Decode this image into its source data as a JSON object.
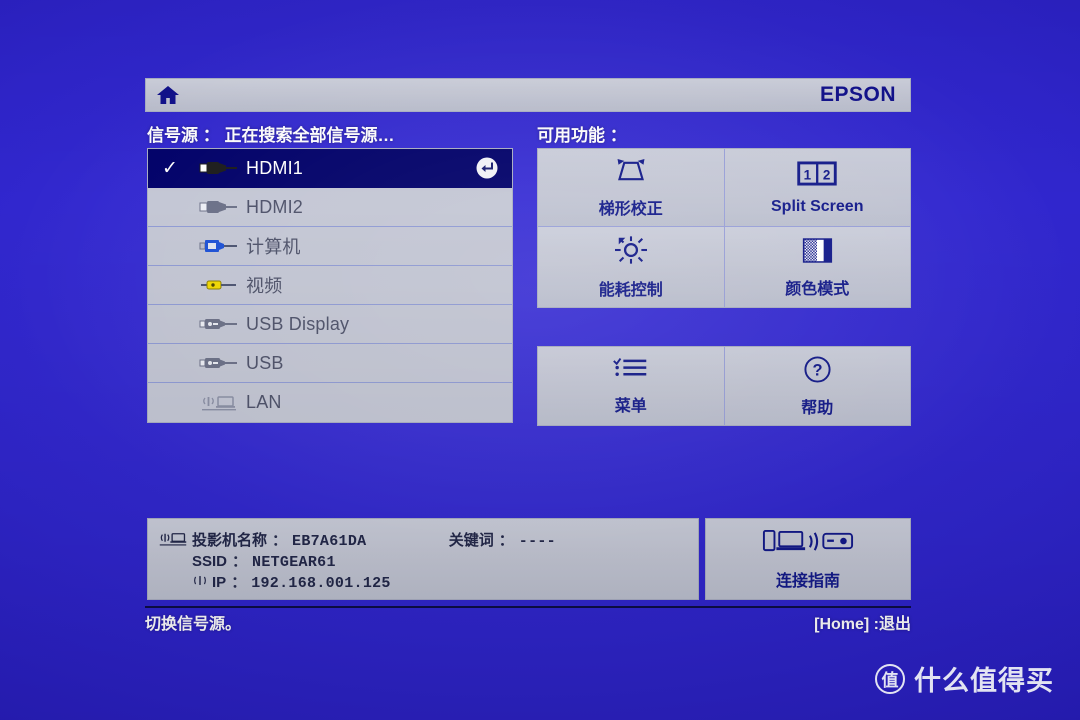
{
  "colors": {
    "background_blue": "#2f25cc",
    "panel_gray": "#c3c6d4",
    "selected_navy": "#000069",
    "icon_navy": "#131a8a",
    "text_white": "#ffffff"
  },
  "header": {
    "home_icon": "home-icon",
    "brand": "EPSON"
  },
  "source_section": {
    "label": "信号源 ： 正在搜索全部信号源…",
    "items": [
      {
        "label": "HDMI1",
        "icon": "hdmi-connector-icon",
        "selected": true,
        "check": "✓",
        "enter_icon": "enter-key-icon"
      },
      {
        "label": "HDMI2",
        "icon": "hdmi-connector-icon",
        "selected": false,
        "check": "",
        "enter_icon": ""
      },
      {
        "label": "计算机",
        "icon": "vga-computer-connector-icon",
        "selected": false,
        "check": "",
        "enter_icon": ""
      },
      {
        "label": "视频",
        "icon": "rca-video-connector-icon",
        "selected": false,
        "check": "",
        "enter_icon": ""
      },
      {
        "label": "USB Display",
        "icon": "usb-connector-icon",
        "selected": false,
        "check": "",
        "enter_icon": ""
      },
      {
        "label": "USB",
        "icon": "usb-connector-icon",
        "selected": false,
        "check": "",
        "enter_icon": ""
      },
      {
        "label": "LAN",
        "icon": "lan-network-icon",
        "selected": false,
        "check": "",
        "enter_icon": ""
      }
    ]
  },
  "function_section": {
    "label": "可用功能 ：",
    "top_grid": [
      {
        "label": "梯形校正",
        "icon": "keystone-trapezoid-icon"
      },
      {
        "label": "Split Screen",
        "icon": "split-screen-icon"
      },
      {
        "label": "能耗控制",
        "icon": "power-consumption-brightness-icon"
      },
      {
        "label": "颜色模式",
        "icon": "color-mode-icon"
      }
    ],
    "bottom_grid": [
      {
        "label": "菜单",
        "icon": "menu-list-icon"
      },
      {
        "label": "帮助",
        "icon": "help-question-icon"
      }
    ]
  },
  "info_panel": {
    "network_icon": "lan-network-icon",
    "rows": [
      {
        "key": "投影机名称",
        "sep": "：",
        "value": "EB7A61DA",
        "icon": ""
      },
      {
        "key": "SSID",
        "sep": "：",
        "value": "NETGEAR61",
        "icon": ""
      },
      {
        "key": "IP",
        "sep": "：",
        "value": "192.168.001.125",
        "icon": "wifi-signal-icon"
      }
    ],
    "keyword": {
      "key": "关键词",
      "sep": "：",
      "value": "----"
    }
  },
  "connection_guide": {
    "label": "连接指南",
    "icon": "device-to-projector-wireless-icon"
  },
  "footer": {
    "hint": "切换信号源。",
    "exit": "[Home] :退出"
  },
  "watermark": {
    "badge": "值",
    "text": "什么值得买"
  }
}
